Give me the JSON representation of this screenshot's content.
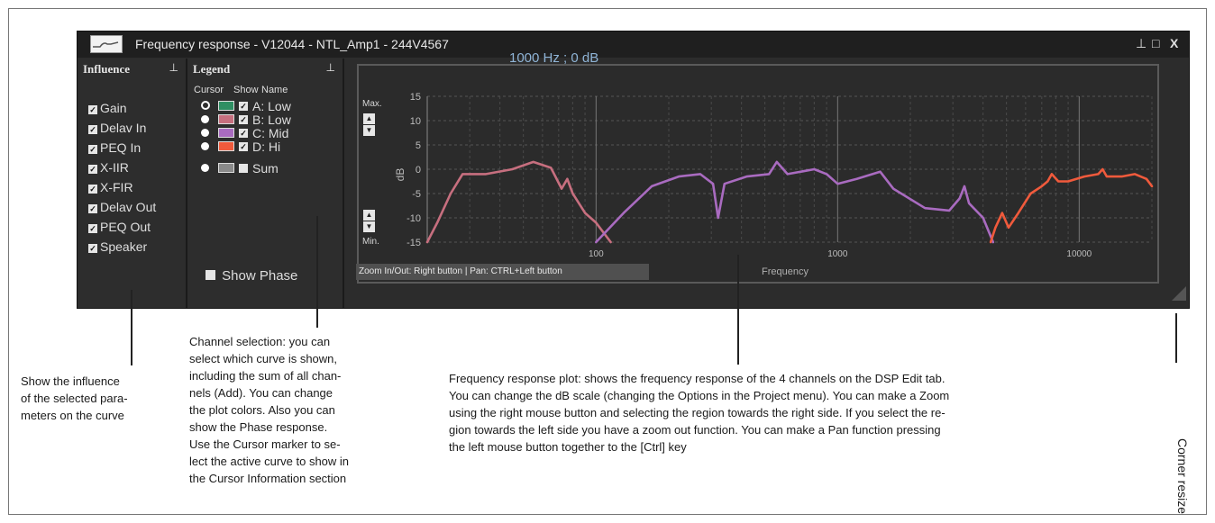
{
  "window": {
    "title": "Frequency response - V12044 - NTL_Amp1 - 244V4567",
    "buttons": {
      "pin": "⊥",
      "maximize": "□",
      "close": "X"
    }
  },
  "influence": {
    "header": "Influence",
    "items": [
      "Gain",
      "Delav In",
      "PEQ In",
      "X-IIR",
      "X-FIR",
      "Delav Out",
      "PEQ Out",
      "Speaker"
    ]
  },
  "legend": {
    "header": "Legend",
    "columns": {
      "cursor": "Cursor",
      "show": "Show",
      "name": "Name"
    },
    "channels": [
      {
        "name": "A: Low",
        "color": "#2f8f63",
        "selected": true,
        "shown": true
      },
      {
        "name": "B: Low",
        "color": "#c76f7f",
        "selected": false,
        "shown": true
      },
      {
        "name": "C: Mid",
        "color": "#a96bc0",
        "selected": false,
        "shown": true
      },
      {
        "name": "D: Hi",
        "color": "#f05a3c",
        "selected": false,
        "shown": true
      },
      {
        "name": "Sum",
        "color": "#8a8a8a",
        "selected": false,
        "shown": false
      }
    ],
    "show_phase": "Show Phase"
  },
  "plot": {
    "cursor_info": "1000 Hz ; 0 dB",
    "max_label": "Max.",
    "min_label": "Min.",
    "ylabel": "dB",
    "xlabel": "Frequency",
    "zoom_hint": "Zoom In/Out: Right button | Pan: CTRL+Left button"
  },
  "chart_data": {
    "type": "line",
    "xlabel": "Frequency",
    "ylabel": "dB",
    "xscale": "log",
    "xlim": [
      20,
      20000
    ],
    "ylim": [
      -15,
      15
    ],
    "x_ticks": [
      "100",
      "1000",
      "10000"
    ],
    "y_ticks": [
      "15",
      "10",
      "5",
      "0",
      "-5",
      "-10",
      "-15"
    ],
    "grid": true,
    "series": [
      {
        "color": "#c76f7f",
        "points": [
          [
            20,
            -15
          ],
          [
            22,
            -11
          ],
          [
            25,
            -5
          ],
          [
            28,
            -1
          ],
          [
            35,
            -1
          ],
          [
            45,
            0
          ],
          [
            55,
            1.5
          ],
          [
            65,
            0.3
          ],
          [
            72,
            -4
          ],
          [
            76,
            -2
          ],
          [
            80,
            -5
          ],
          [
            90,
            -9
          ],
          [
            100,
            -11
          ],
          [
            115,
            -15
          ]
        ]
      },
      {
        "color": "#a96bc0",
        "points": [
          [
            100,
            -15
          ],
          [
            130,
            -9
          ],
          [
            170,
            -3.5
          ],
          [
            220,
            -1.5
          ],
          [
            270,
            -1
          ],
          [
            305,
            -3
          ],
          [
            320,
            -10
          ],
          [
            340,
            -3
          ],
          [
            420,
            -1.5
          ],
          [
            520,
            -1
          ],
          [
            560,
            1.5
          ],
          [
            620,
            -1
          ],
          [
            800,
            0
          ],
          [
            900,
            -1
          ],
          [
            1000,
            -3
          ],
          [
            1200,
            -2
          ],
          [
            1500,
            -0.5
          ],
          [
            1700,
            -4
          ],
          [
            2300,
            -8
          ],
          [
            2900,
            -8.5
          ],
          [
            3200,
            -6
          ],
          [
            3350,
            -3.5
          ],
          [
            3500,
            -7
          ],
          [
            4000,
            -10
          ],
          [
            4400,
            -15
          ]
        ]
      },
      {
        "color": "#f05a3c",
        "points": [
          [
            4300,
            -15
          ],
          [
            4500,
            -12
          ],
          [
            4800,
            -9
          ],
          [
            5100,
            -12
          ],
          [
            5600,
            -9
          ],
          [
            6300,
            -5
          ],
          [
            7000,
            -3.5
          ],
          [
            7400,
            -2.5
          ],
          [
            7700,
            -1
          ],
          [
            8200,
            -2.5
          ],
          [
            9000,
            -2.5
          ],
          [
            10500,
            -1.5
          ],
          [
            12000,
            -1
          ],
          [
            12500,
            0
          ],
          [
            13000,
            -1.5
          ],
          [
            15000,
            -1.5
          ],
          [
            17000,
            -1
          ],
          [
            19000,
            -2
          ],
          [
            20000,
            -3.5
          ]
        ]
      }
    ]
  },
  "callouts": {
    "influence": [
      "Show the influence",
      "of the selected para-",
      "meters on the curve"
    ],
    "channel": [
      "Channel selection: you can",
      "select which curve is shown,",
      "including the sum of all chan-",
      "nels (Add). You can change",
      "the plot colors. Also you can",
      "show the Phase response.",
      "Use the Cursor marker to se-",
      "lect the active curve to show in",
      "the Cursor Information section"
    ],
    "plot": [
      "Frequency response plot: shows the frequency response of the 4 channels on the DSP Edit tab.",
      "You can change the dB scale (changing the Options in the Project menu). You can make a Zoom",
      "using the right mouse button and selecting the region towards the right side. If you select the re-",
      "gion towards the left side you have a zoom out function. You can make a Pan function pressing",
      "the left mouse button together to the [Ctrl] key"
    ],
    "corner": "Corner resize"
  }
}
